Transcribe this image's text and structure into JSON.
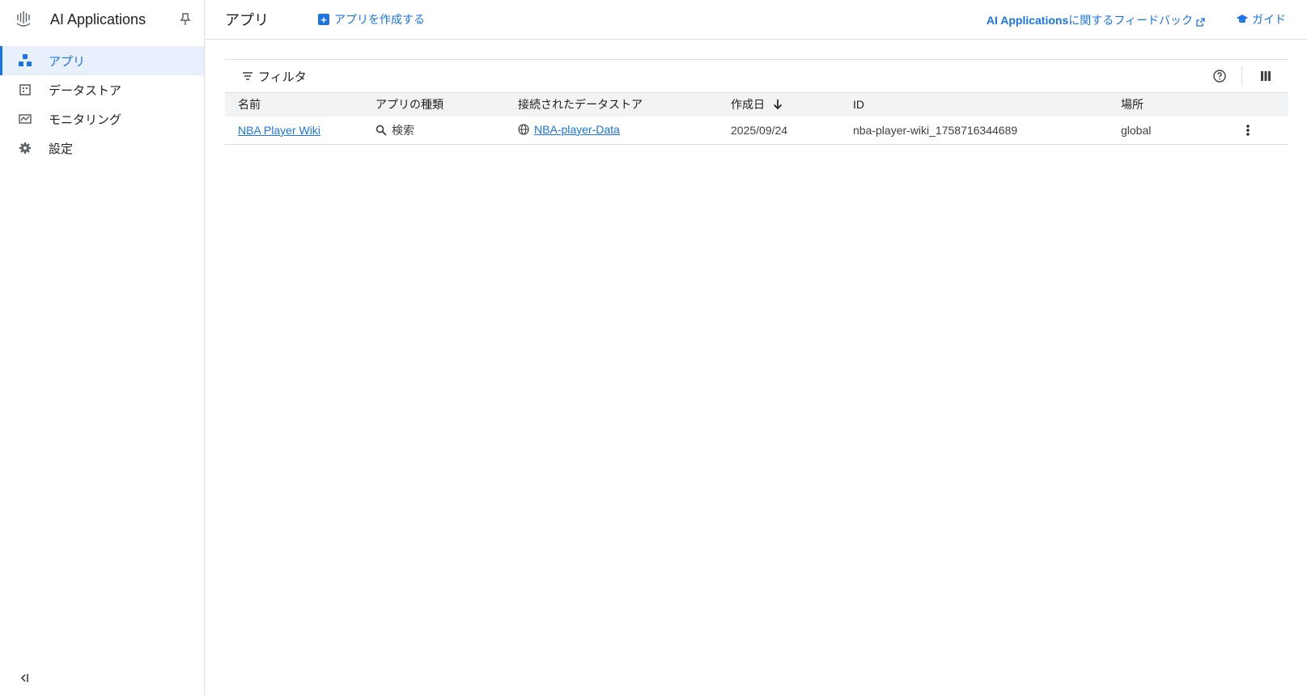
{
  "sidebar": {
    "title": "AI Applications",
    "items": [
      {
        "label": "アプリ",
        "icon": "apps-icon"
      },
      {
        "label": "データストア",
        "icon": "datastore-icon"
      },
      {
        "label": "モニタリング",
        "icon": "monitoring-icon"
      },
      {
        "label": "設定",
        "icon": "gear-icon"
      }
    ],
    "active_index": 0
  },
  "header": {
    "title": "アプリ",
    "create_label": "アプリを作成する",
    "feedback_bold": "AI Applications",
    "feedback_rest": " に関するフィードバック",
    "guide_label": "ガイド"
  },
  "toolbar": {
    "filter_label": "フィルタ"
  },
  "table": {
    "columns": [
      "名前",
      "アプリの種類",
      "接続されたデータストア",
      "作成日",
      "ID",
      "場所"
    ],
    "sort_column": "作成日",
    "sort_direction": "descending",
    "rows": [
      {
        "name": "NBA Player Wiki",
        "type": "検索",
        "datastore": "NBA-player-Data",
        "created": "2025/09/24",
        "id": "nba-player-wiki_1758716344689",
        "location": "global"
      }
    ]
  },
  "colors": {
    "accent": "#1a73e8",
    "active_bg": "#e8f0fe",
    "header_bg": "#f1f3f4",
    "border": "#dadce0"
  }
}
